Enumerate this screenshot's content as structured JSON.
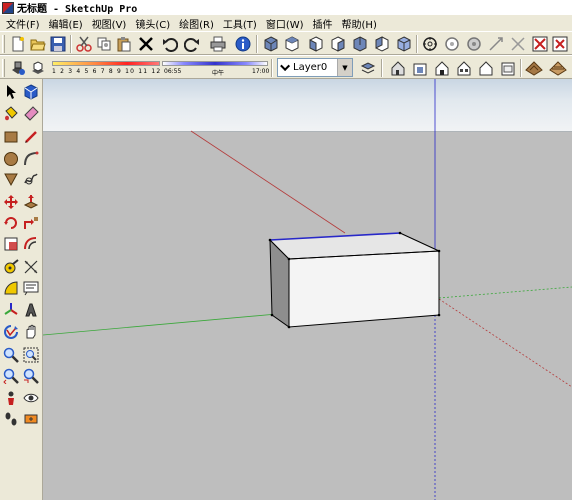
{
  "window": {
    "title": "无标题 - SketchUp Pro"
  },
  "menu": [
    "文件(F)",
    "编辑(E)",
    "视图(V)",
    "镜头(C)",
    "绘图(R)",
    "工具(T)",
    "窗口(W)",
    "插件",
    "帮助(H)"
  ],
  "shadow": {
    "months": "1 2 3 4 5 6 7 8 9 10 11 12",
    "time_start": "06:55",
    "time_noon": "中午",
    "time_end": "17:00"
  },
  "layer": {
    "current": "Layer0"
  },
  "toolbar_icons": [
    "new-file-icon",
    "open-file-icon",
    "save-icon",
    "cut-icon",
    "copy-icon",
    "paste-icon",
    "erase-icon",
    "undo-icon",
    "redo-icon",
    "print-icon",
    "model-info-icon",
    "iso-view-icon",
    "top-view-icon",
    "front-view-icon",
    "right-view-icon",
    "back-view-icon",
    "left-view-icon",
    "x-ray-icon",
    "wireframe-icon",
    "hidden-line-icon",
    "shaded-icon",
    "textured-icon",
    "monochrome-icon"
  ],
  "colors": {
    "axis_red": "#b43c3c",
    "axis_green": "#3aa83a",
    "axis_blue": "#2828c8",
    "viewport_ground": "#bebebe",
    "box_face": "#f4f4f4",
    "box_side": "#8e8e8e"
  }
}
